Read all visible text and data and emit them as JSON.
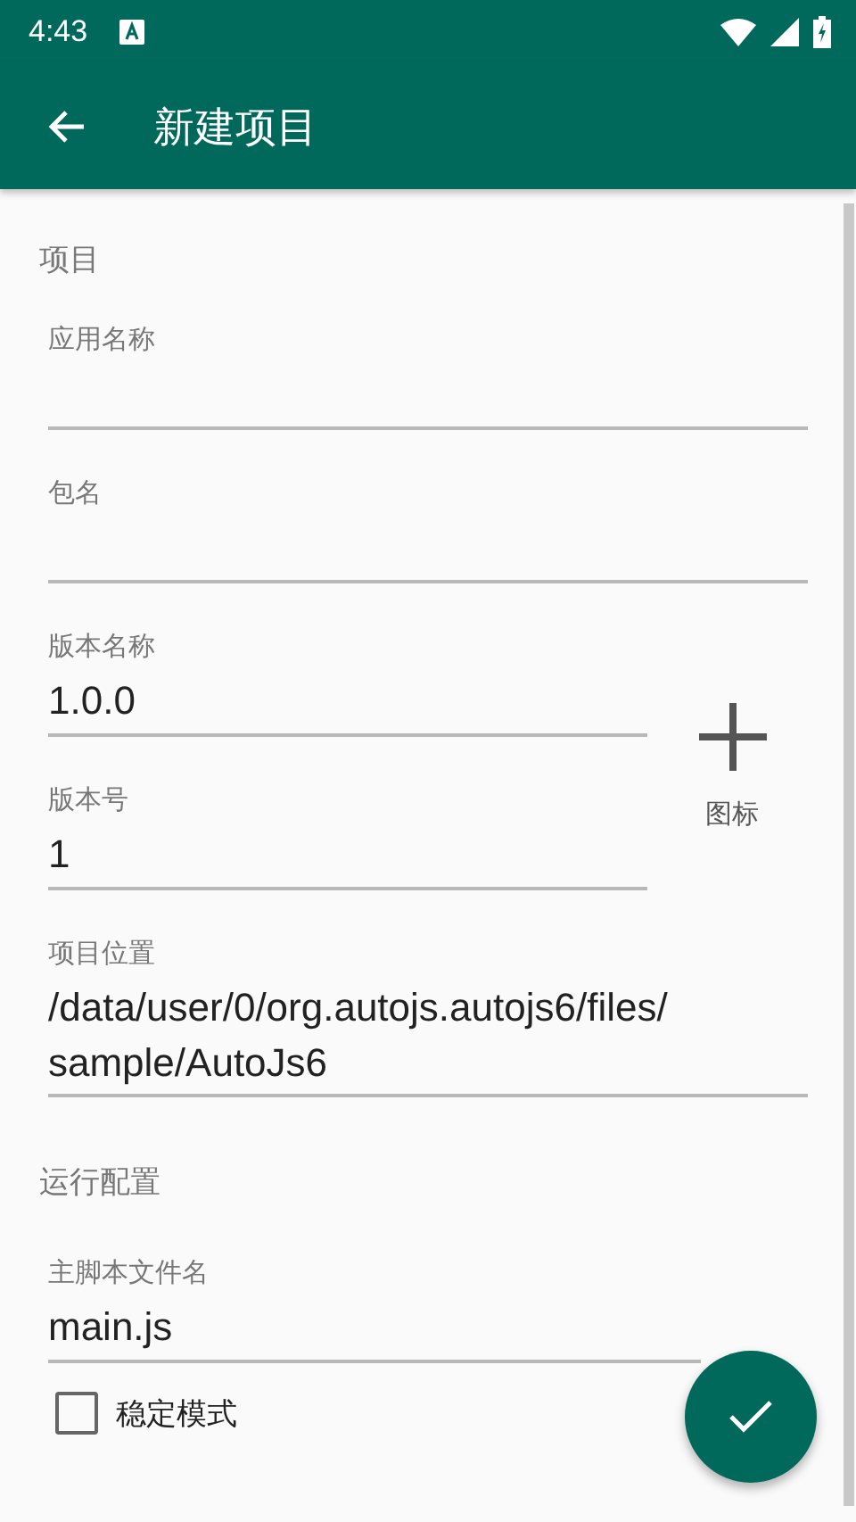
{
  "status_bar": {
    "time": "4:43"
  },
  "toolbar": {
    "title": "新建项目"
  },
  "project": {
    "title": "项目",
    "fields": [
      {
        "label": "应用名称"
      },
      {
        "label": "包名"
      }
    ],
    "version_fields": [
      {
        "label": "版本名称",
        "value": "1.0.0"
      },
      {
        "label": "版本号",
        "value": "1"
      }
    ],
    "icon_picker": {
      "label": "图标"
    },
    "location": {
      "label": "项目位置",
      "value": "/data/user/0/org.autojs.autojs6/files/\nsample/AutoJs6"
    }
  },
  "run_config": {
    "title": "运行配置",
    "main_script": {
      "label": "主脚本文件名",
      "value": "main.js"
    },
    "stable_mode": {
      "label": "稳定模式",
      "checked": false
    }
  }
}
